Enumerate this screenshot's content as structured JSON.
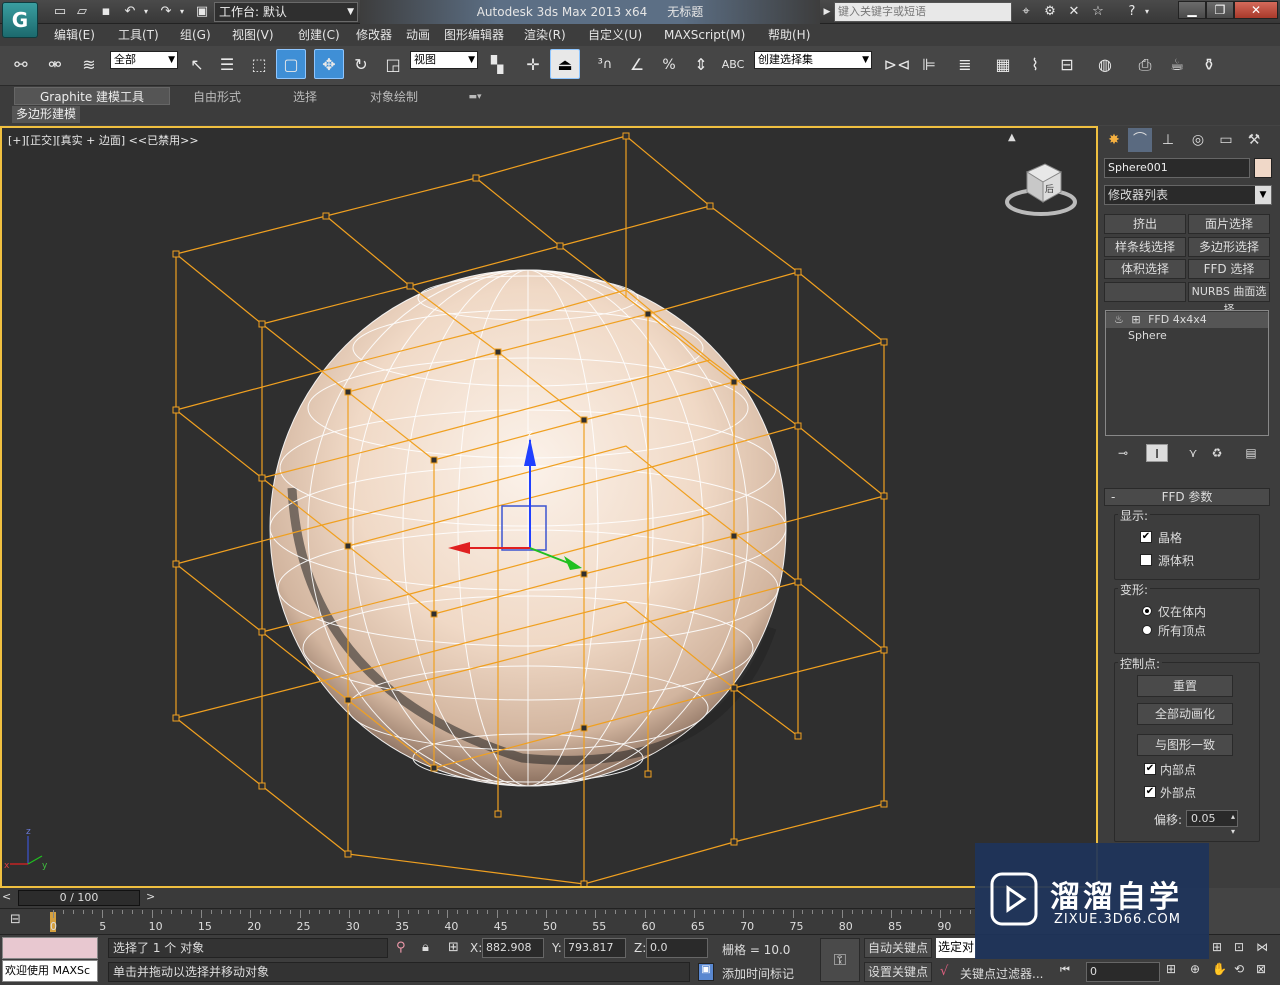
{
  "titlebar": {
    "workspace_label": "工作台: 默认",
    "app_name": "Autodesk 3ds Max  2013 x64",
    "doc_title": "无标题",
    "search_placeholder": "键入关键字或短语"
  },
  "menu": [
    "编辑(E)",
    "工具(T)",
    "组(G)",
    "视图(V)",
    "创建(C)",
    "修改器",
    "动画",
    "图形编辑器",
    "渲染(R)",
    "自定义(U)",
    "MAXScript(M)",
    "帮助(H)"
  ],
  "toolbar": {
    "filter_select": "全部",
    "ref_coord_select": "视图",
    "named_selection": "创建选择集"
  },
  "ribbon": {
    "tabs": [
      "Graphite 建模工具",
      "自由形式",
      "选择",
      "对象绘制"
    ],
    "panel_label": "多边形建模"
  },
  "viewport": {
    "label": "[+][正交][真实 + 边面] <<已禁用>>",
    "gizmo_z": "z",
    "viewcube_text": "后",
    "axis_x": "x",
    "axis_y": "y",
    "axis_z": "z"
  },
  "command_panel": {
    "object_name": "Sphere001",
    "modifier_list": "修改器列表",
    "mod_buttons": [
      "挤出",
      "面片选择",
      "样条线选择",
      "多边形选择",
      "体积选择",
      "FFD 选择",
      "",
      "NURBS 曲面选择"
    ],
    "stack": [
      "FFD 4x4x4",
      "Sphere"
    ],
    "rollout_title": "FFD 参数",
    "display_group": "显示:",
    "lattice_label": "晶格",
    "source_volume_label": "源体积",
    "deform_group": "变形:",
    "inside_label": "仅在体内",
    "all_vertices_label": "所有顶点",
    "control_points_group": "控制点:",
    "reset_label": "重置",
    "animate_all_label": "全部动画化",
    "conform_label": "与图形一致",
    "interior_label": "内部点",
    "exterior_label": "外部点",
    "offset_label": "偏移:",
    "offset_value": "0.05"
  },
  "timeline": {
    "frame_display": "0 / 100",
    "ticks": [
      "0",
      "5",
      "10",
      "15",
      "20",
      "25",
      "30",
      "35",
      "40",
      "45",
      "50",
      "55",
      "60",
      "65",
      "70",
      "75",
      "80",
      "85",
      "90"
    ]
  },
  "status": {
    "maxscript_welcome": "欢迎使用 MAXSc",
    "selection": "选择了 1 个 对象",
    "prompt": "单击并拖动以选择并移动对象",
    "x_label": "X:",
    "x_value": "882.908",
    "y_label": "Y:",
    "y_value": "793.817",
    "z_label": "Z:",
    "z_value": "0.0",
    "grid": "栅格 = 10.0",
    "add_time_tag": "添加时间标记",
    "auto_key": "自动关键点",
    "set_key": "设置关键点",
    "selected_field": "选定对",
    "key_filters": "关键点过滤器...",
    "frame_field": "0"
  },
  "watermark": {
    "title": "溜溜自学",
    "url": "ZIXUE.3D66.COM"
  },
  "colors": {
    "ffd_lattice": "#f0a020",
    "sphere": "#f2ddcc",
    "viewport_bg": "#2f2f2f",
    "active_border": "#f0c040",
    "watermark_bg": "#1e345a"
  }
}
